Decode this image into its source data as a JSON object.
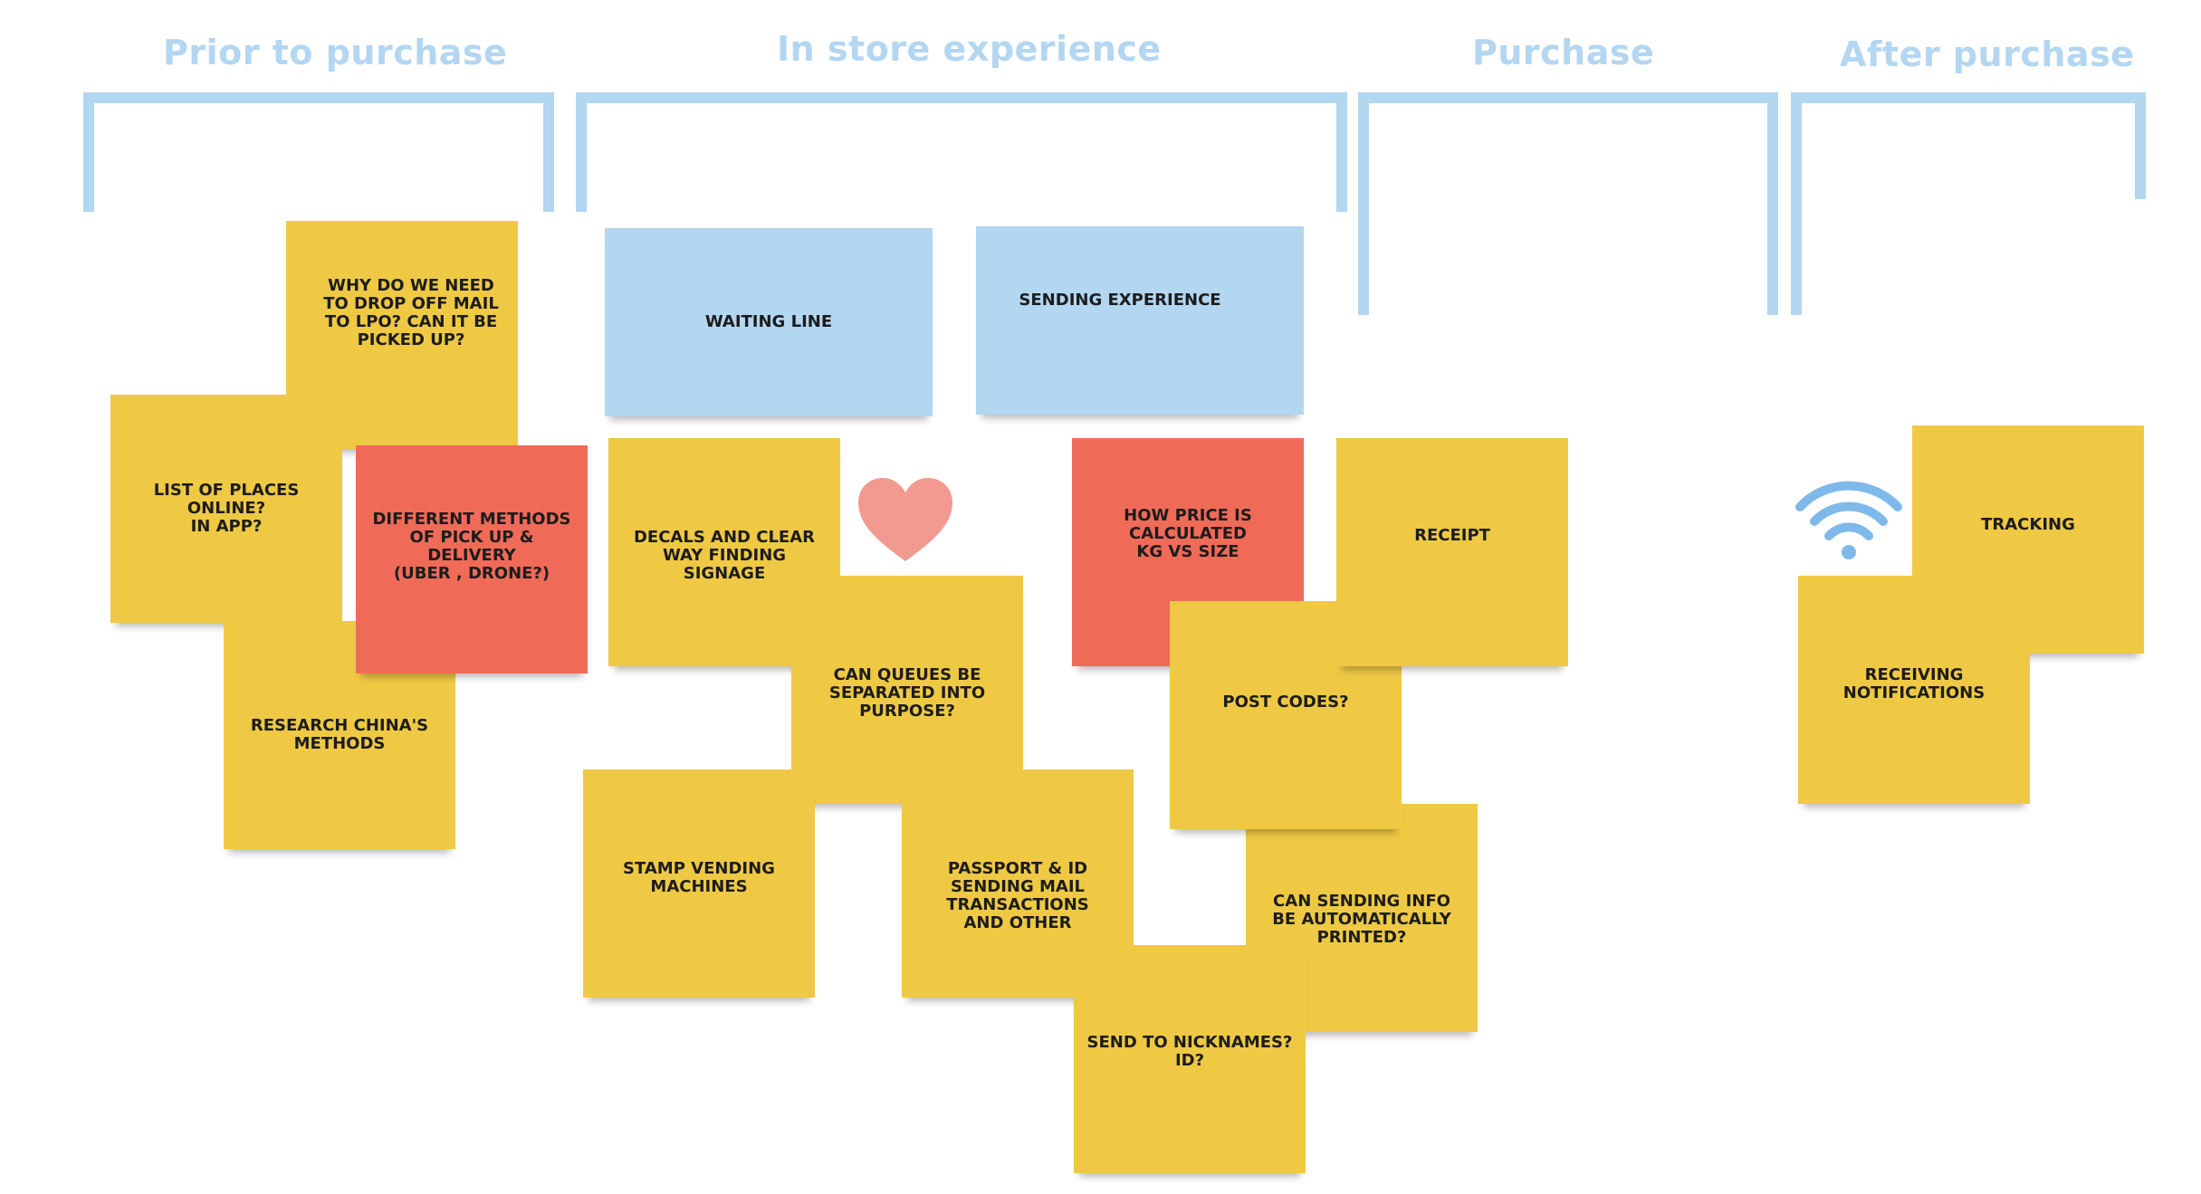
{
  "colors": {
    "heading": "#b3d6f1",
    "bracket": "#b3d6f1",
    "sticky_yellow": "#efc944",
    "sticky_red": "#ef6b58",
    "sticky_blue": "#b3d6f1",
    "heart": "#f29a90",
    "wifi": "#7fb9ea"
  },
  "stages": {
    "prior": "Prior to purchase",
    "in_store": "In store experience",
    "purchase": "Purchase",
    "after": "After purchase"
  },
  "notes": {
    "drop_off": "Why do we need\nto drop off mail\nto LPO? Can it be\npicked up?",
    "places_online": "List of places online?\nIn app?",
    "pickup_methods": "Different methods\nof pick up & delivery\n(Uber , drone?)",
    "research_china": "Research China's\nmethods",
    "waiting_line": "Waiting line",
    "sending_experience": "Sending experience",
    "decals": "Decals and clear\nway finding\nsignage",
    "queues": "Can queues be\nseparated into\npurpose?",
    "stamp_vending": "Stamp vending\nmachines",
    "passport": "Passport & ID\nsending mail\ntransactions\nand other",
    "price": "How price is\ncalculated\nKG vs size",
    "receipt": "Receipt",
    "post_codes": "Post codes?",
    "auto_print": "Can sending info\nbe automatically\nprinted?",
    "nicknames": "Send to nicknames?\nID?",
    "tracking": "Tracking",
    "notifications": "Receiving\nnotifications"
  },
  "icons": {
    "heart": "heart-icon",
    "wifi": "wifi-icon"
  }
}
